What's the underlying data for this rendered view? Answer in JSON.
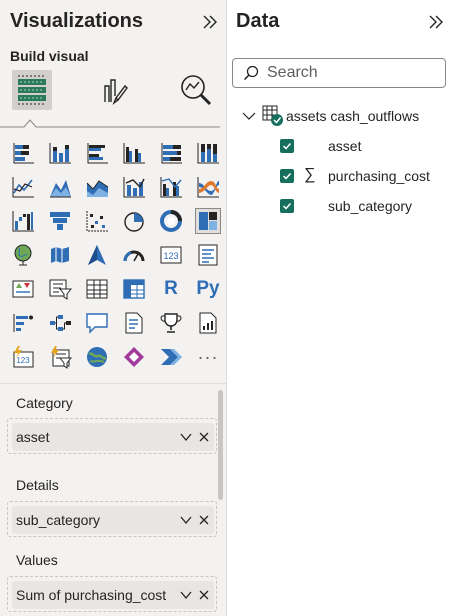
{
  "visualizations": {
    "title": "Visualizations",
    "build_visual_label": "Build visual",
    "modes": [
      {
        "name": "build-visual",
        "icon": "build-visual-icon",
        "active": true
      },
      {
        "name": "format-visual",
        "icon": "format-visual-icon",
        "active": false
      },
      {
        "name": "analytics",
        "icon": "analytics-icon",
        "active": false
      }
    ],
    "gallery": [
      [
        "stacked-bar-chart-icon",
        "stacked-column-chart-icon",
        "clustered-bar-chart-icon",
        "clustered-column-chart-icon",
        "100-stacked-bar-chart-icon",
        "100-stacked-column-chart-icon"
      ],
      [
        "line-chart-icon",
        "area-chart-icon",
        "stacked-area-chart-icon",
        "line-and-stacked-column-icon",
        "line-and-clustered-column-icon",
        "ribbon-chart-icon"
      ],
      [
        "waterfall-chart-icon",
        "funnel-chart-icon",
        "scatter-chart-icon",
        "pie-chart-icon",
        "donut-chart-icon",
        "treemap-icon"
      ],
      [
        "map-icon",
        "filled-map-icon",
        "azure-map-icon",
        "gauge-icon",
        "card-icon",
        "multi-row-card-icon"
      ],
      [
        "kpi-icon",
        "slicer-icon",
        "table-icon",
        "matrix-icon",
        "r-script-visual-icon",
        "python-visual-icon"
      ],
      [
        "key-influencers-icon",
        "decomposition-tree-icon",
        "qa-icon",
        "smart-narrative-icon",
        "metrics-icon",
        "paginated-report-icon"
      ],
      [
        "power-apps-icon",
        "power-automate-icon",
        "arcgis-map-icon",
        "power-apps-diamond-icon",
        "power-automate-flow-icon",
        "more-visuals-icon"
      ]
    ],
    "gallery_text": {
      "r": "R",
      "py": "Py",
      "more": "···"
    },
    "selected_visual": "treemap-icon",
    "wells": {
      "category": {
        "label": "Category",
        "value": "asset"
      },
      "details": {
        "label": "Details",
        "value": "sub_category"
      },
      "values": {
        "label": "Values",
        "value": "Sum of purchasing_cost"
      }
    }
  },
  "data": {
    "title": "Data",
    "search_placeholder": "Search",
    "table": {
      "name": "assets cash_outflows",
      "fields": [
        {
          "label": "asset",
          "checked": true,
          "sigma": false
        },
        {
          "label": "purchasing_cost",
          "checked": true,
          "sigma": true
        },
        {
          "label": "sub_category",
          "checked": true,
          "sigma": false
        }
      ]
    }
  },
  "colors": {
    "pane_bg": "#f3f2f1",
    "accent_blue": "#2f6db5",
    "check_green": "#166f5d",
    "text": "#252423"
  }
}
